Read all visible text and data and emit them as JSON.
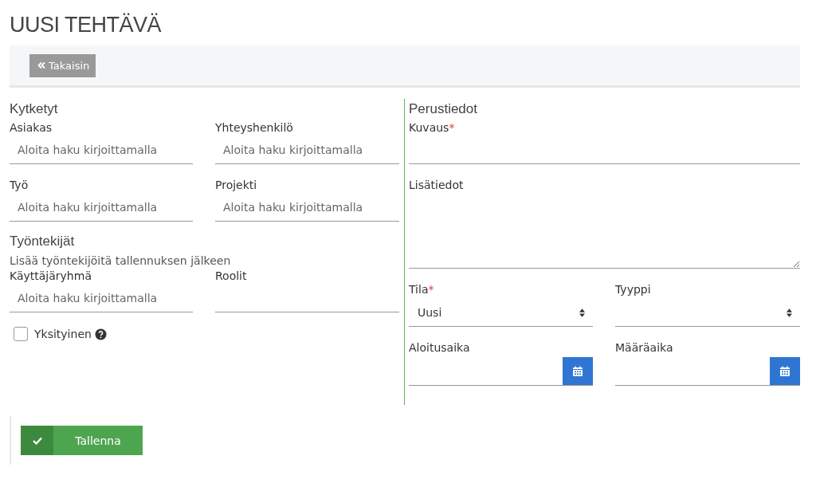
{
  "page_title": "UUSI TEHTÄVÄ",
  "toolbar": {
    "back_button": "Takaisin"
  },
  "left": {
    "sections": [
      {
        "heading": "Kytketyt",
        "fields": [
          {
            "label": "Asiakas",
            "placeholder": "Aloita haku kirjoittamalla"
          },
          {
            "label": "Yhteyshenkilö",
            "placeholder": "Aloita haku kirjoittamalla"
          },
          {
            "label": "Työ",
            "placeholder": "Aloita haku kirjoittamalla"
          },
          {
            "label": "Projekti",
            "placeholder": "Aloita haku kirjoittamalla"
          }
        ]
      },
      {
        "heading": "Työntekijät",
        "note": "Lisää työntekijöitä tallennuksen jälkeen",
        "fields": [
          {
            "label": "Käyttäjäryhmä",
            "placeholder": "Aloita haku kirjoittamalla"
          },
          {
            "label": "Roolit"
          }
        ]
      }
    ],
    "private_checkbox": {
      "label": "Yksityinen",
      "checked": false
    }
  },
  "right": {
    "heading": "Perustiedot",
    "fields": [
      {
        "kind": "text",
        "label": "Kuvaus",
        "required_mark": "*"
      },
      {
        "kind": "textarea",
        "label": "Lisätiedot"
      },
      {
        "kind": "select",
        "label": "Tila",
        "required_mark": "*",
        "value": "Uusi"
      },
      {
        "kind": "select",
        "label": "Tyyppi"
      },
      {
        "kind": "date",
        "label": "Aloitusaika"
      },
      {
        "kind": "date",
        "label": "Määräaika"
      }
    ]
  },
  "save_button": "Tallenna"
}
